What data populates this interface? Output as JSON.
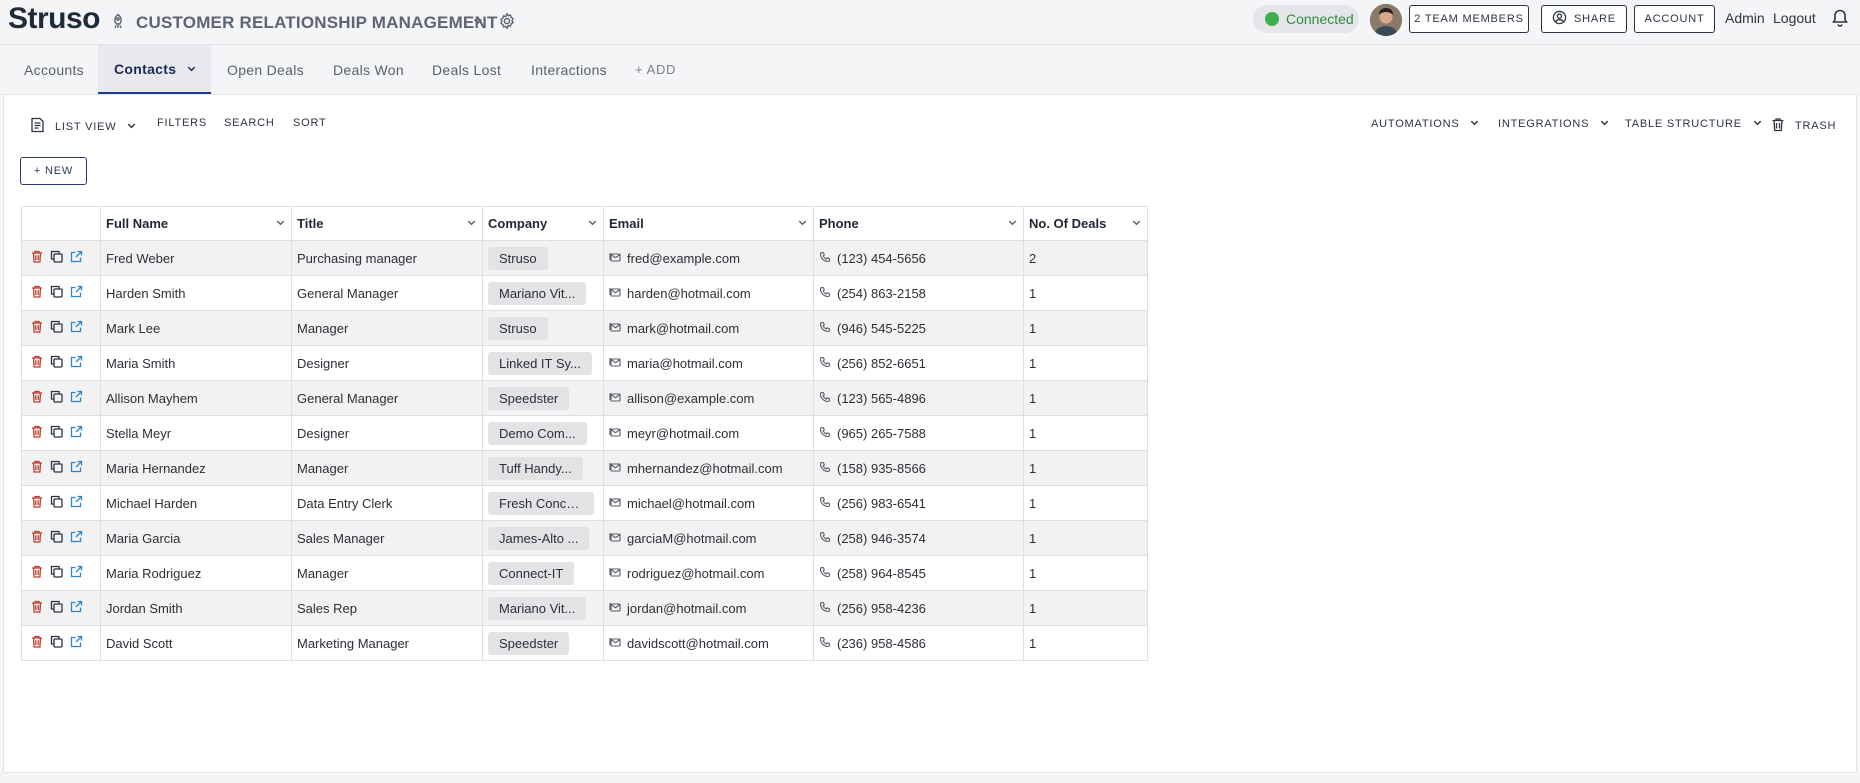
{
  "header": {
    "logo": "Struso",
    "app_title": "CUSTOMER RELATIONSHIP MANAGEMENT",
    "status": "Connected",
    "team_members": "2 TEAM MEMBERS",
    "share": "SHARE",
    "account": "ACCOUNT",
    "admin": "Admin",
    "logout": "Logout"
  },
  "tabs": [
    {
      "label": "Accounts"
    },
    {
      "label": "Contacts"
    },
    {
      "label": "Open Deals"
    },
    {
      "label": "Deals Won"
    },
    {
      "label": "Deals Lost"
    },
    {
      "label": "Interactions"
    }
  ],
  "add_tab": "+ ADD",
  "toolbar": {
    "list_view": "LIST VIEW",
    "filters": "FILTERS",
    "search": "SEARCH",
    "sort": "SORT",
    "automations": "AUTOMATIONS",
    "integrations": "INTEGRATIONS",
    "table_structure": "TABLE STRUCTURE",
    "trash": "TRASH",
    "new": "+ NEW"
  },
  "table": {
    "columns": [
      "Full Name",
      "Title",
      "Company",
      "Email",
      "Phone",
      "No. Of Deals"
    ],
    "rows": [
      {
        "name": "Fred Weber",
        "title": "Purchasing manager",
        "company": "Struso",
        "email": "fred@example.com",
        "phone": "(123) 454-5656",
        "deals": "2"
      },
      {
        "name": "Harden Smith",
        "title": "General Manager",
        "company": "Mariano Vit...",
        "email": "harden@hotmail.com",
        "phone": "(254) 863-2158",
        "deals": "1"
      },
      {
        "name": "Mark Lee",
        "title": "Manager",
        "company": "Struso",
        "email": "mark@hotmail.com",
        "phone": "(946) 545-5225",
        "deals": "1"
      },
      {
        "name": "Maria Smith",
        "title": "Designer",
        "company": "Linked IT Sy...",
        "email": "maria@hotmail.com",
        "phone": "(256) 852-6651",
        "deals": "1"
      },
      {
        "name": "Allison Mayhem",
        "title": "General Manager",
        "company": "Speedster",
        "email": "allison@example.com",
        "phone": "(123) 565-4896",
        "deals": "1"
      },
      {
        "name": "Stella Meyr",
        "title": "Designer",
        "company": "Demo Com...",
        "email": "meyr@hotmail.com",
        "phone": "(965) 265-7588",
        "deals": "1"
      },
      {
        "name": "Maria Hernandez",
        "title": "Manager",
        "company": "Tuff Handy...",
        "email": "mhernandez@hotmail.com",
        "phone": "(158) 935-8566",
        "deals": "1"
      },
      {
        "name": "Michael Harden",
        "title": "Data Entry Clerk",
        "company": "Fresh Conce...",
        "email": "michael@hotmail.com",
        "phone": "(256) 983-6541",
        "deals": "1"
      },
      {
        "name": "Maria Garcia",
        "title": "Sales Manager",
        "company": "James-Alto ...",
        "email": "garciaM@hotmail.com",
        "phone": "(258) 946-3574",
        "deals": "1"
      },
      {
        "name": "Maria Rodriguez",
        "title": "Manager",
        "company": "Connect-IT",
        "email": "rodriguez@hotmail.com",
        "phone": "(258) 964-8545",
        "deals": "1"
      },
      {
        "name": "Jordan Smith",
        "title": "Sales Rep",
        "company": "Mariano Vit...",
        "email": "jordan@hotmail.com",
        "phone": "(256) 958-4236",
        "deals": "1"
      },
      {
        "name": "David Scott",
        "title": "Marketing Manager",
        "company": "Speedster",
        "email": "davidscott@hotmail.com",
        "phone": "(236) 958-4586",
        "deals": "1"
      }
    ]
  },
  "colors": {
    "status_green": "#3fae4f",
    "active_tab_underline": "#1f3a8a",
    "delete_red": "#c0392b",
    "open_blue": "#2e86c9"
  },
  "icons": [
    "bell-icon",
    "gear-icon",
    "rocket-icon",
    "chevron-down-icon",
    "trash-icon",
    "copy-icon",
    "open-external-icon",
    "email-icon",
    "phone-icon",
    "list-view-icon",
    "user-circle-icon"
  ]
}
